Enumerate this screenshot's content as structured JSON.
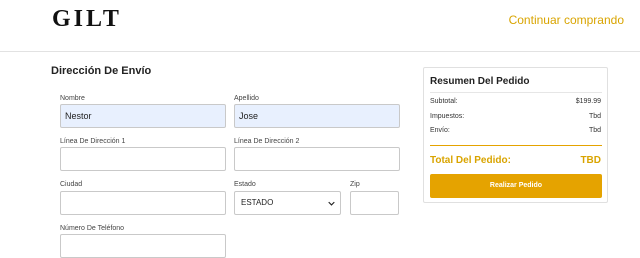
{
  "header": {
    "logo_text": "GILT",
    "continue_label": "Continuar comprando"
  },
  "shipping": {
    "title": "Dirección De Envío",
    "first_name": {
      "label": "Nombre",
      "value": "Nestor"
    },
    "last_name": {
      "label": "Apellido",
      "value": "Jose"
    },
    "address1": {
      "label": "Línea De Dirección 1",
      "value": ""
    },
    "address2": {
      "label": "Línea De Dirección 2",
      "value": ""
    },
    "city": {
      "label": "Ciudad",
      "value": ""
    },
    "state": {
      "label": "Estado",
      "selected": "ESTADO"
    },
    "zip": {
      "label": "Zip",
      "value": ""
    },
    "phone": {
      "label": "Número De Teléfono",
      "value": ""
    }
  },
  "summary": {
    "title": "Resumen Del Pedido",
    "subtotal_label": "Subtotal:",
    "subtotal_value": "$199.99",
    "taxes_label": "Impuestos:",
    "taxes_value": "Tbd",
    "shipping_label": "Envío:",
    "shipping_value": "Tbd",
    "total_label": "Total Del Pedido:",
    "total_value": "TBD",
    "place_order_label": "Realizar Pedido"
  },
  "colors": {
    "accent": "#e5a300",
    "accent_text": "#d9a400",
    "autofill_bg": "#e8f0fe"
  }
}
